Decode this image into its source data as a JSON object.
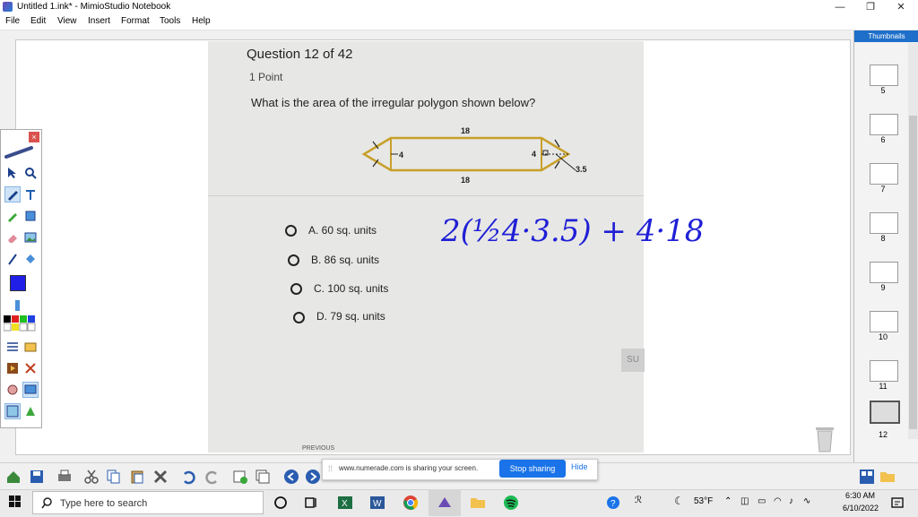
{
  "window": {
    "title": "Untitled 1.ink* - MimioStudio Notebook",
    "controls": [
      "—",
      "❐",
      "✕"
    ]
  },
  "menu": [
    "File",
    "Edit",
    "View",
    "Insert",
    "Format",
    "Tools",
    "Help"
  ],
  "question": {
    "header": "Question 12 of 42",
    "points": "1 Point",
    "prompt": "What is the area of the irregular polygon shown below?",
    "figure_labels": {
      "top": "18",
      "bottom": "18",
      "left_height": "4",
      "right_height": "4",
      "slant": "3.5"
    },
    "options": [
      {
        "label": "A.  60 sq. units"
      },
      {
        "label": "B.  86 sq. units"
      },
      {
        "label": "C.  100 sq. units"
      },
      {
        "label": "D.  79 sq. units"
      }
    ],
    "submit_partial": "SU",
    "previous_partial": "PREVIOUS"
  },
  "handwriting": "2(½4·3.5) + 4·18",
  "thumbnails": {
    "header": "Thumbnails",
    "pages": [
      "5",
      "6",
      "7",
      "8",
      "9",
      "10",
      "11",
      "12"
    ],
    "active": "12"
  },
  "share_banner": {
    "message": "www.numerade.com is sharing your screen.",
    "stop_label": "Stop sharing",
    "hide_label": "Hide"
  },
  "taskbar": {
    "search_placeholder": "Type here to search",
    "weather": "53°F",
    "time": "6:30 AM",
    "date": "6/10/2022"
  },
  "colors": {
    "accent_blue": "#1a73e8",
    "ink_blue": "#1f1fd6",
    "polygon_stroke": "#c8a02a",
    "thumb_header": "#1e6fc9"
  }
}
